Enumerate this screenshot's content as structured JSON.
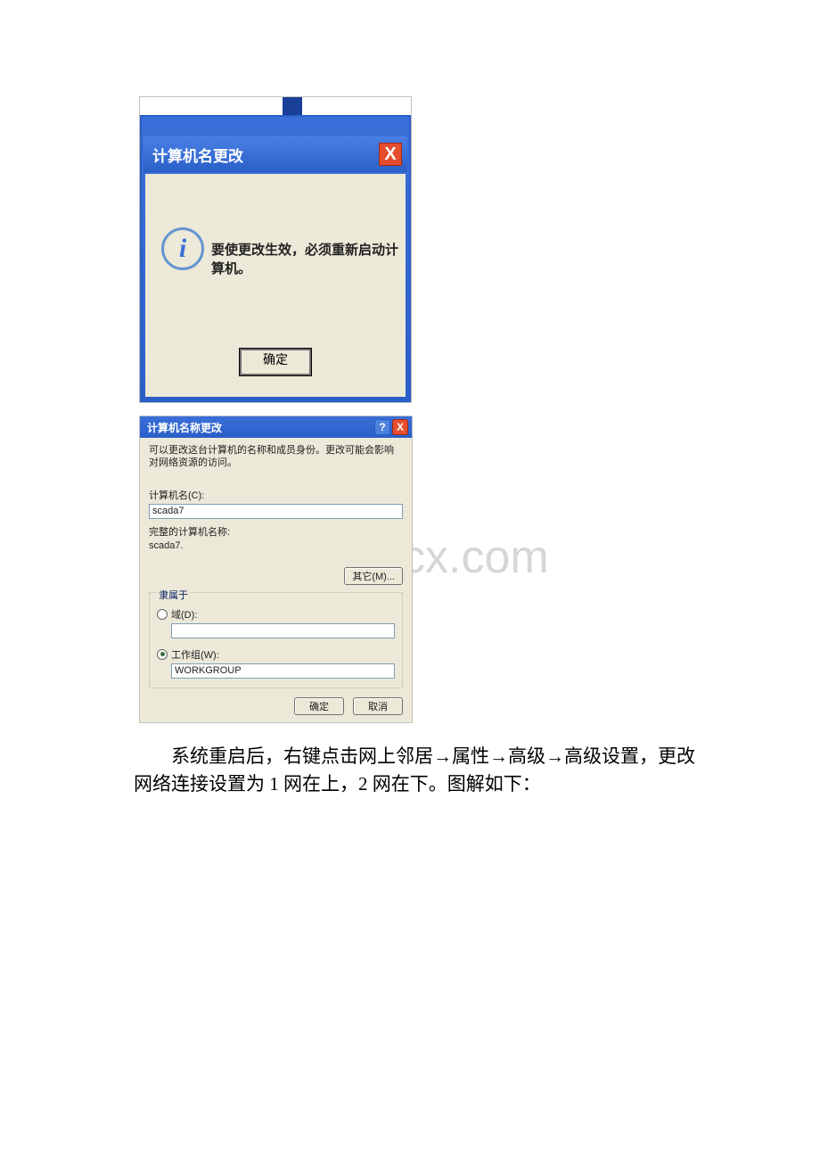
{
  "watermark": "www.bdocx.com",
  "dialog1": {
    "title": "计算机名更改",
    "close_label": "X",
    "icon_letter": "i",
    "message": "要使更改生效，必须重新启动计算机。",
    "ok_label": "确定"
  },
  "dialog2": {
    "title": "计算机名称更改",
    "help_label": "?",
    "close_label": "X",
    "description": "可以更改这台计算机的名称和成员身份。更改可能会影响对网络资源的访问。",
    "name_label": "计算机名(C):",
    "name_value": "scada7",
    "fullname_label": "完整的计算机名称:",
    "fullname_value": "scada7.",
    "other_button": "其它(M)...",
    "group": {
      "label": "隶属于",
      "domain_label": "域(D):",
      "domain_value": "",
      "workgroup_label": "工作组(W):",
      "workgroup_value": "WORKGROUP",
      "selected": "workgroup"
    },
    "ok_label": "确定",
    "cancel_label": "取消"
  },
  "body_paragraph": "系统重启后，右键点击网上邻居→属性→高级→高级设置，更改网络连接设置为 1 网在上，2 网在下。图解如下："
}
